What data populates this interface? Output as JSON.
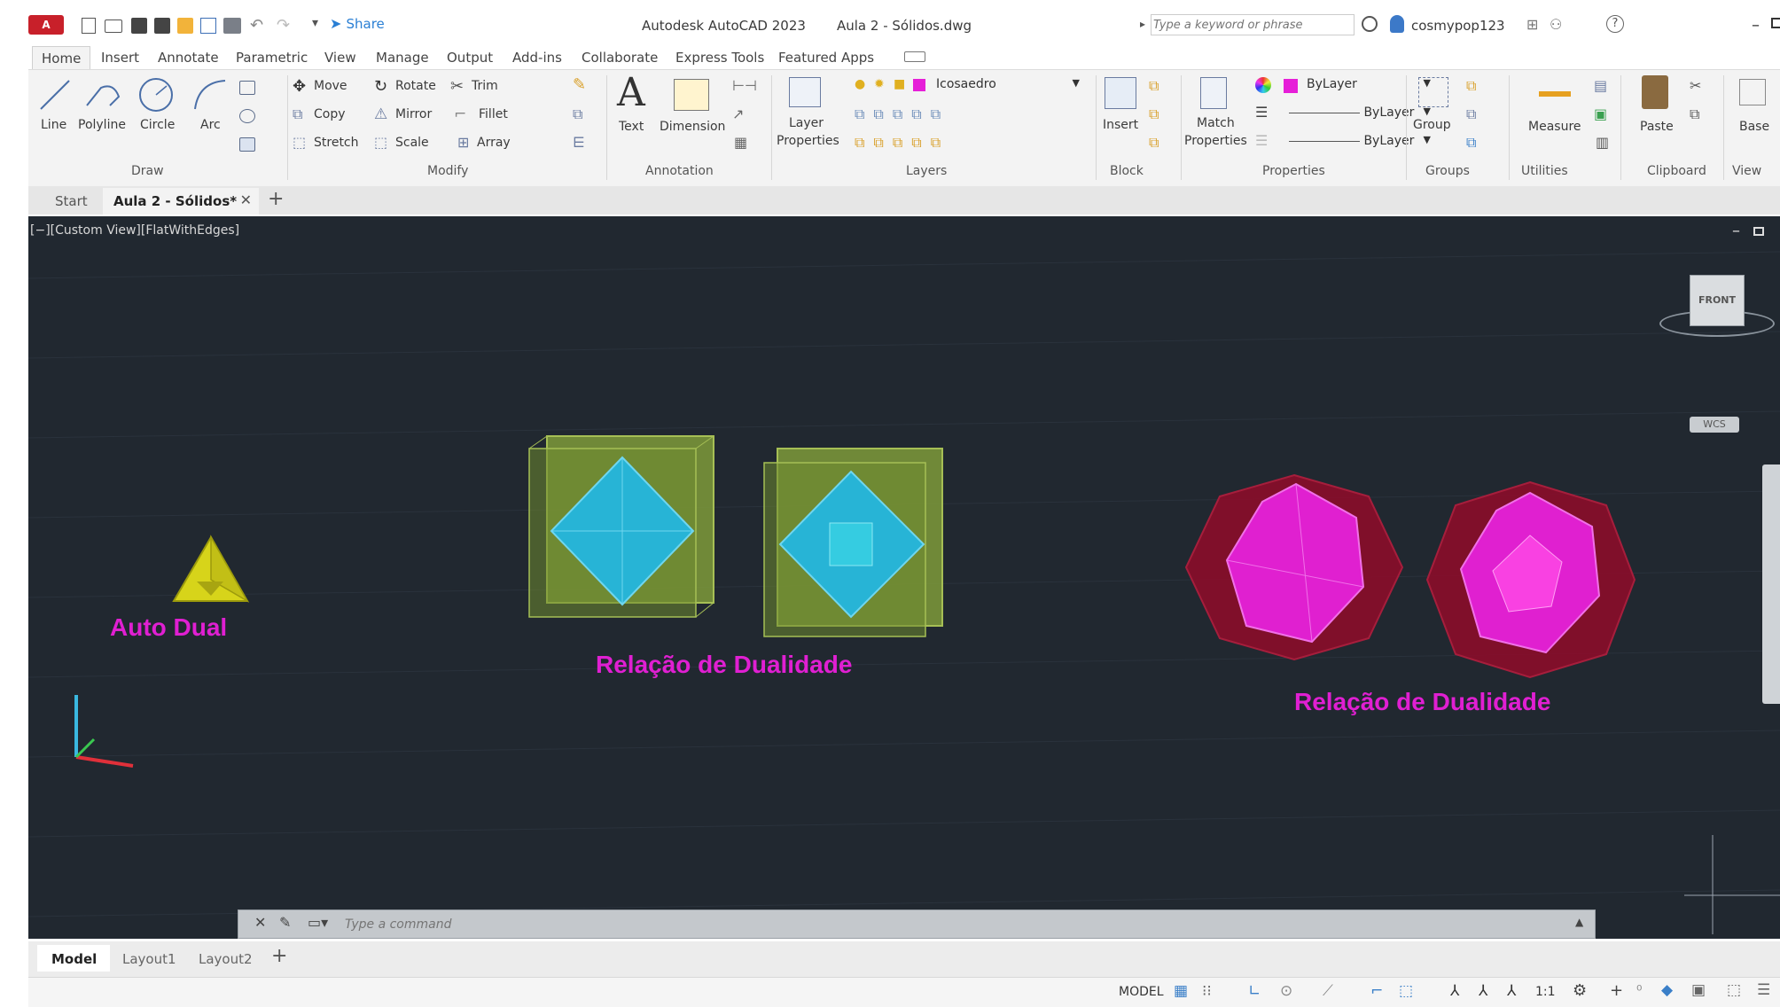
{
  "app": {
    "title": "Autodesk AutoCAD 2023",
    "file": "Aula 2 - Sólidos.dwg",
    "logo_text": "A CAD",
    "share_label": "Share",
    "search_placeholder": "Type a keyword or phrase",
    "username": "cosmypop123"
  },
  "ribbon_tabs": [
    "Home",
    "Insert",
    "Annotate",
    "Parametric",
    "View",
    "Manage",
    "Output",
    "Add-ins",
    "Collaborate",
    "Express Tools",
    "Featured Apps"
  ],
  "active_ribbon_tab": "Home",
  "ribbon": {
    "draw": {
      "title": "Draw",
      "line": "Line",
      "polyline": "Polyline",
      "circle": "Circle",
      "arc": "Arc"
    },
    "modify": {
      "title": "Modify",
      "move": "Move",
      "rotate": "Rotate",
      "trim": "Trim",
      "copy": "Copy",
      "mirror": "Mirror",
      "fillet": "Fillet",
      "stretch": "Stretch",
      "scale": "Scale",
      "array": "Array"
    },
    "annotation": {
      "title": "Annotation",
      "text": "Text",
      "dimension": "Dimension"
    },
    "layers": {
      "title": "Layers",
      "properties_line1": "Layer",
      "properties_line2": "Properties",
      "current_layer": "Icosaedro",
      "layer_color": "#e61fd8"
    },
    "block": {
      "title": "Block",
      "insert": "Insert"
    },
    "properties": {
      "title": "Properties",
      "match_line1": "Match",
      "match_line2": "Properties",
      "color": "ByLayer",
      "linetype": "ByLayer",
      "lineweight": "ByLayer",
      "color_swatch": "#e61fd8"
    },
    "groups": {
      "title": "Groups",
      "group": "Group"
    },
    "utilities": {
      "title": "Utilities",
      "measure": "Measure"
    },
    "clipboard": {
      "title": "Clipboard",
      "paste": "Paste"
    },
    "view": {
      "title": "View",
      "base": "Base"
    }
  },
  "doc_tabs": {
    "start": "Start",
    "active": "Aula 2 - Sólidos*"
  },
  "viewport": {
    "header": "[−][Custom View][FlatWithEdges]",
    "viewcube_face": "FRONT",
    "viewcube_wcs": "WCS",
    "labels": {
      "auto_dual": "Auto Dual",
      "duality_1": "Relação de Dualidade",
      "duality_2": "Relação de Dualidade"
    },
    "colors": {
      "background": "#212830",
      "label": "#e01fd2",
      "tetra": "#d7d41a",
      "cube": "#8aa83a",
      "octa": "#27b4d6",
      "icosa": "#e020d0",
      "dodeca": "#8b0c2a"
    }
  },
  "command_line": {
    "placeholder": "Type a command"
  },
  "layout_tabs": [
    "Model",
    "Layout1",
    "Layout2"
  ],
  "active_layout_tab": "Model",
  "status": {
    "model": "MODEL",
    "scale": "1:1"
  }
}
